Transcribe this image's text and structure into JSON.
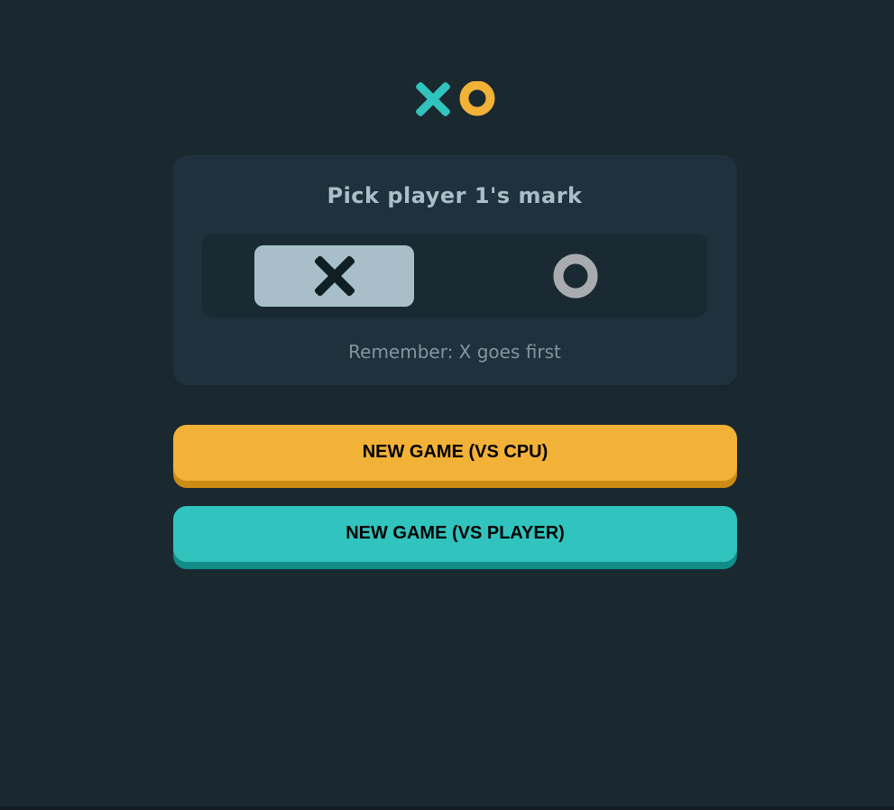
{
  "logo": {
    "x_icon": "x-mark-icon",
    "o_icon": "o-mark-icon",
    "x_color": "#31c3bd",
    "o_color": "#f2b137"
  },
  "picker": {
    "title": "Pick player 1's mark",
    "options": [
      {
        "mark": "X",
        "icon": "x-mark-icon",
        "selected": true
      },
      {
        "mark": "O",
        "icon": "o-mark-icon",
        "selected": false
      }
    ],
    "reminder": "Remember: X goes first"
  },
  "buttons": {
    "vs_cpu": "NEW GAME (VS CPU)",
    "vs_player": "NEW GAME (VS PLAYER)"
  },
  "colors": {
    "background": "#1a2830",
    "card": "#1f313c",
    "silver": "#a8bfc9",
    "yellow": "#f2b137",
    "teal": "#31c3bd"
  }
}
